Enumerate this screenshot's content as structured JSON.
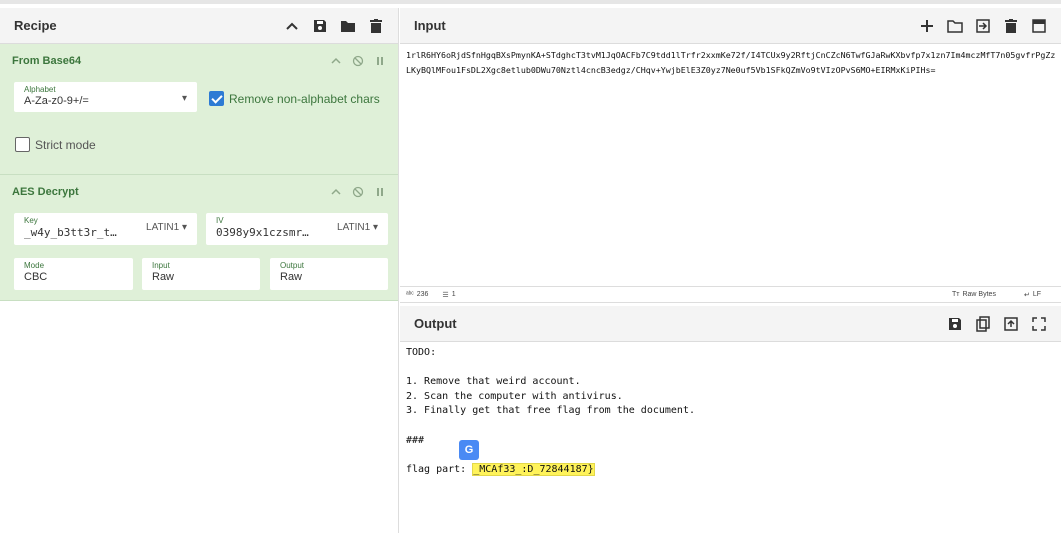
{
  "recipe": {
    "title": "Recipe",
    "ops": [
      {
        "name": "From Base64",
        "alphabet_label": "Alphabet",
        "alphabet_value": "A-Za-z0-9+/=",
        "remove_nonalpha_label": "Remove non-alphabet chars",
        "remove_nonalpha_checked": true,
        "strict_label": "Strict mode",
        "strict_checked": false
      },
      {
        "name": "AES Decrypt",
        "key_label": "Key",
        "key_value": "_w4y_b3tt3r_t…",
        "key_encoding": "LATIN1",
        "iv_label": "IV",
        "iv_value": "0398y9x1czsmr…",
        "iv_encoding": "LATIN1",
        "mode_label": "Mode",
        "mode_value": "CBC",
        "input_label": "Input",
        "input_value": "Raw",
        "output_label": "Output",
        "output_value": "Raw"
      }
    ]
  },
  "input": {
    "title": "Input",
    "text": "1rlR6HY6oRjdSfnHgqBXsPmynKA+STdghcT3tvM1JqOACFb7C9tdd1lTrfr2xxmKe72f/I4TCUx9y2RftjCnCZcN6TwfGJaRwKXbvfp7x1zn7Im4mczMfT7n05gvfrPgZzLKyBQlMFou1FsDL2Xgc8etlub0DWu70Nztl4cncB3edgz/CHqv+YwjbElE3Z0yz7Ne0uf5Vb1SFkQZmVo9tVIzOPvS6MO+EIRMxKiPIHs=",
    "char_count": "236",
    "line_count": "1",
    "raw_bytes": "Raw Bytes",
    "eol": "LF"
  },
  "output": {
    "title": "Output",
    "line1": "TODO:",
    "line2": "",
    "line3": "1. Remove that weird account.",
    "line4": "2. Scan the computer with antivirus.",
    "line5": "3. Finally get that free flag from the document.",
    "line6": "",
    "line7": "###",
    "line8": "",
    "flag_prefix": "flag part: ",
    "flag_value": "_MCAf33_:D_72844187}"
  },
  "colors": {
    "op_bg": "#dff0d8",
    "op_text": "#3c763d",
    "highlight": "#fff35a",
    "accent": "#2d7bd4"
  }
}
